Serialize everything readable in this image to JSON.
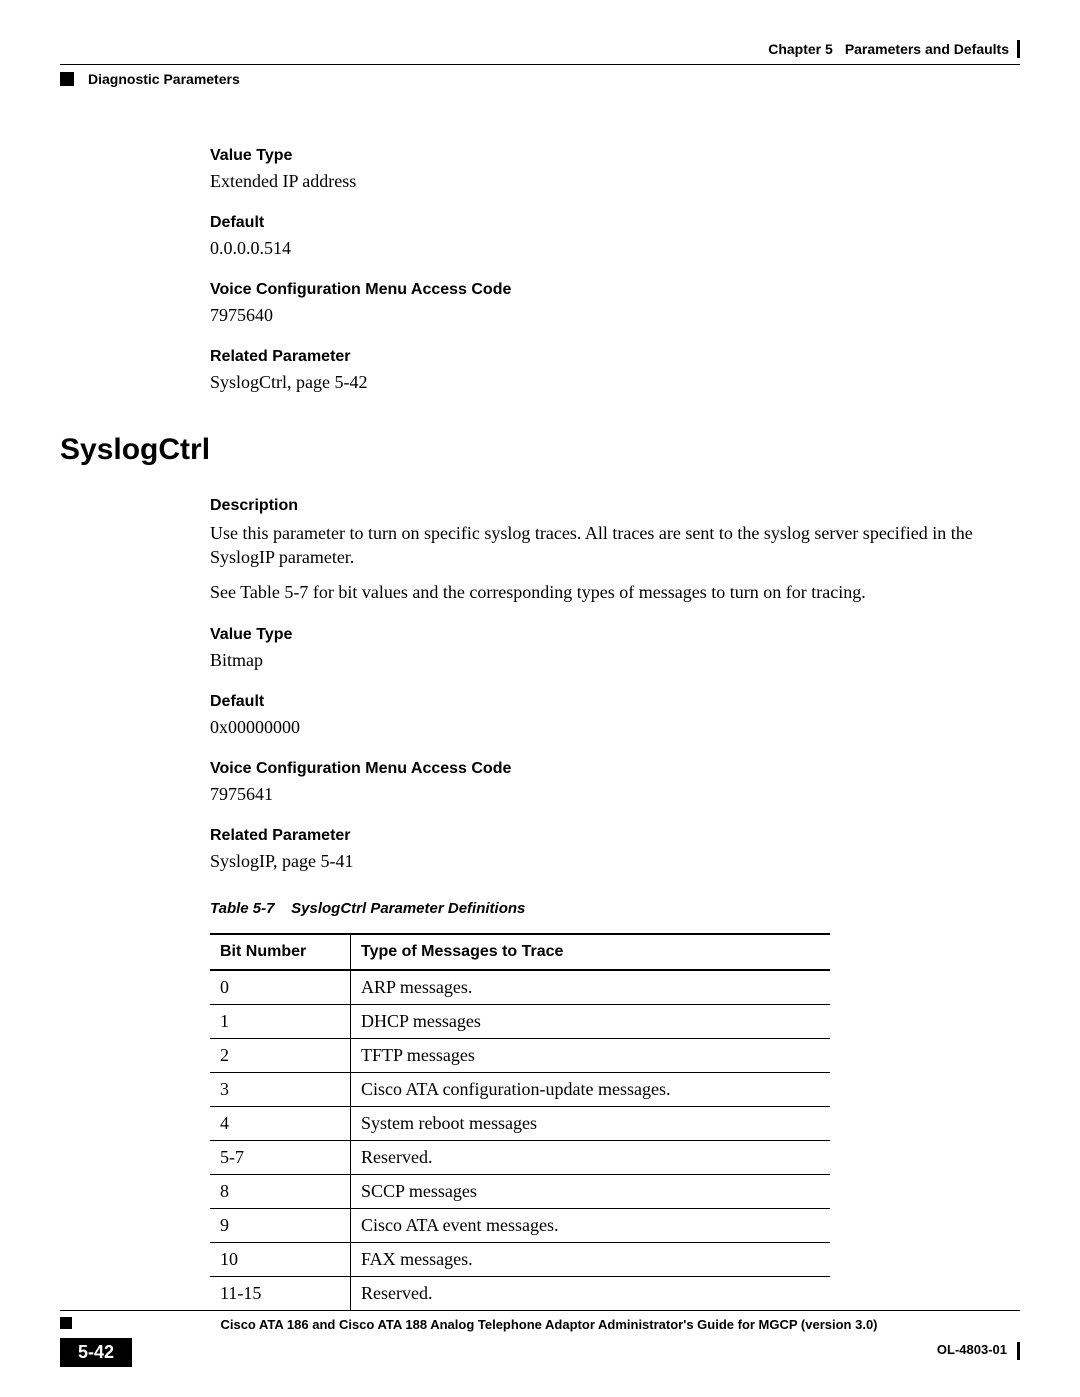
{
  "header": {
    "chapter_label": "Chapter 5",
    "chapter_title": "Parameters and Defaults",
    "section": "Diagnostic Parameters"
  },
  "param1": {
    "value_type_label": "Value Type",
    "value_type": "Extended IP address",
    "default_label": "Default",
    "default": "0.0.0.0.514",
    "vcmac_label": "Voice Configuration Menu Access Code",
    "vcmac": "7975640",
    "related_label": "Related Parameter",
    "related": "SyslogCtrl, page 5-42"
  },
  "heading": "SyslogCtrl",
  "param2": {
    "desc_label": "Description",
    "desc1": "Use this parameter to turn on specific syslog traces. All traces are sent to the syslog server specified in the SyslogIP parameter.",
    "desc2": "See Table 5-7 for bit values and the corresponding types of messages to turn on for tracing.",
    "value_type_label": "Value Type",
    "value_type": "Bitmap",
    "default_label": "Default",
    "default": "0x00000000",
    "vcmac_label": "Voice Configuration Menu Access Code",
    "vcmac": "7975641",
    "related_label": "Related Parameter",
    "related": "SyslogIP, page 5-41"
  },
  "table": {
    "caption_prefix": "Table 5-7",
    "caption_title": "SyslogCtrl Parameter Definitions",
    "col1": "Bit Number",
    "col2": "Type of Messages to Trace",
    "rows": [
      {
        "bit": "0",
        "msg": "ARP messages."
      },
      {
        "bit": "1",
        "msg": "DHCP messages"
      },
      {
        "bit": "2",
        "msg": "TFTP messages"
      },
      {
        "bit": "3",
        "msg": "Cisco ATA configuration-update messages."
      },
      {
        "bit": "4",
        "msg": "System reboot messages"
      },
      {
        "bit": "5-7",
        "msg": "Reserved."
      },
      {
        "bit": "8",
        "msg": "SCCP messages"
      },
      {
        "bit": "9",
        "msg": "Cisco ATA event messages."
      },
      {
        "bit": "10",
        "msg": "FAX messages."
      },
      {
        "bit": "11-15",
        "msg": "Reserved."
      }
    ]
  },
  "footer": {
    "book": "Cisco ATA 186 and Cisco ATA 188 Analog Telephone Adaptor Administrator's Guide for MGCP (version 3.0)",
    "page": "5-42",
    "docnum": "OL-4803-01"
  }
}
